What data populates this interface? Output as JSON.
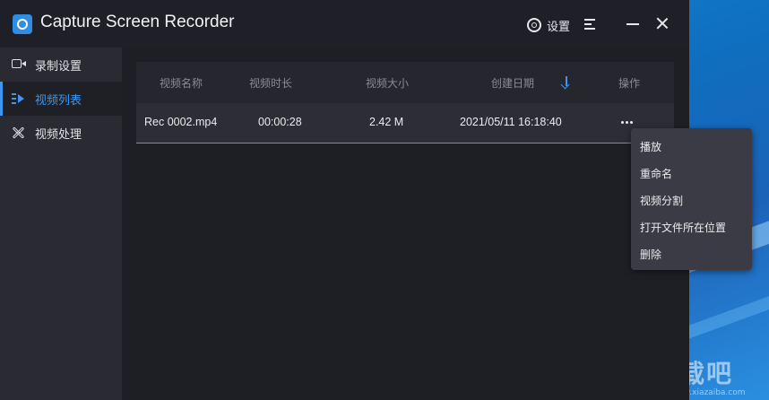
{
  "app": {
    "title": "Capture Screen Recorder",
    "settings_label": "设置"
  },
  "sidebar": {
    "items": [
      {
        "label": "录制设置",
        "icon": "camera-icon",
        "active": false
      },
      {
        "label": "视频列表",
        "icon": "list-play-icon",
        "active": true
      },
      {
        "label": "视频处理",
        "icon": "tools-icon",
        "active": false
      }
    ]
  },
  "table": {
    "columns": [
      "视频名称",
      "视频时长",
      "视频大小",
      "创建日期",
      "操作"
    ],
    "sort_column": "创建日期",
    "rows": [
      {
        "name": "Rec 0002.mp4",
        "duration": "00:00:28",
        "size": "2.42 M",
        "date": "2021/05/11 16:18:40"
      }
    ]
  },
  "context_menu": {
    "items": [
      "播放",
      "重命名",
      "视频分割",
      "打开文件所在位置",
      "删除"
    ]
  },
  "watermark": {
    "text": "下载吧",
    "url": "www.xiazaiba.com"
  },
  "colors": {
    "accent": "#3d96f0",
    "window_bg": "#1e1f25",
    "sidebar_bg": "#2a2b32",
    "menu_bg": "#3a3b44"
  }
}
